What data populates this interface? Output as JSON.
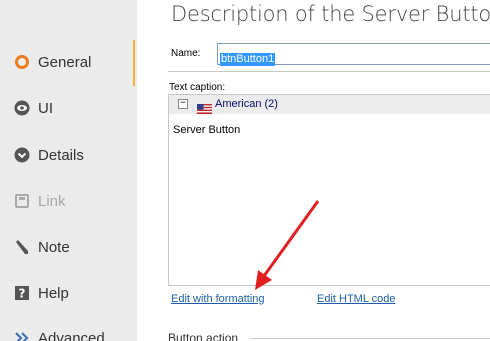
{
  "sidebar": {
    "items": [
      {
        "label": "General",
        "icon": "radio-circle-icon",
        "active": true,
        "enabled": true
      },
      {
        "label": "UI",
        "icon": "eye-icon",
        "active": false,
        "enabled": true
      },
      {
        "label": "Details",
        "icon": "chevron-circle-icon",
        "active": false,
        "enabled": true
      },
      {
        "label": "Link",
        "icon": "link-square-icon",
        "active": false,
        "enabled": false
      },
      {
        "label": "Note",
        "icon": "pencil-icon",
        "active": false,
        "enabled": true
      },
      {
        "label": "Help",
        "icon": "question-icon",
        "active": false,
        "enabled": true
      },
      {
        "label": "Advanced",
        "icon": "double-chevron-icon",
        "active": false,
        "enabled": true
      }
    ],
    "accent_color": "#f2b23f"
  },
  "main": {
    "title": "Description of the Server Button",
    "name_label": "Name:",
    "name_value": "btnButton1",
    "caption_label": "Text caption:",
    "language": "American (2)",
    "caption_value": "Server Button",
    "edit_formatting_link": "Edit with formatting",
    "edit_html_link": "Edit HTML code",
    "section_title": "Button action"
  },
  "colors": {
    "link": "#1b5fa8",
    "selection": "#3399ff",
    "arrow": "#e02020"
  }
}
